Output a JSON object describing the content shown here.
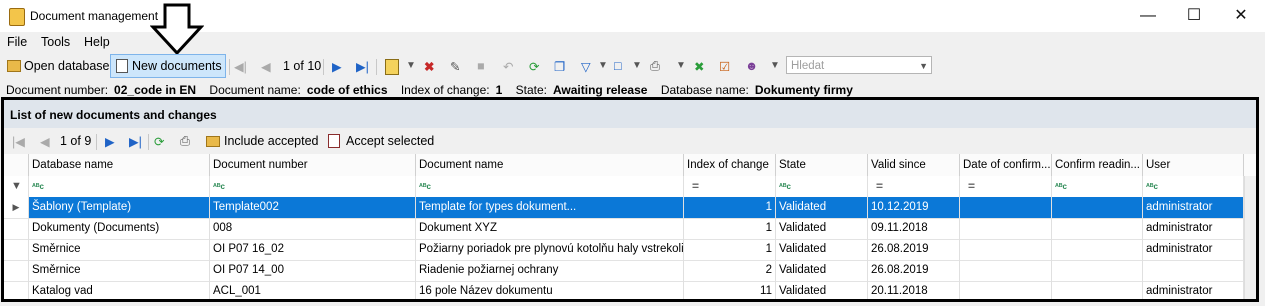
{
  "window": {
    "title": "Document management"
  },
  "menu": [
    "File",
    "Tools",
    "Help"
  ],
  "toolbar": {
    "open_database": "Open database",
    "new_documents": "New documents",
    "page_info": "1 of 10",
    "search_placeholder": "Hledat"
  },
  "info": {
    "document_number_label": "Document number:",
    "document_number": "02_code in EN",
    "document_name_label": "Document name:",
    "document_name": "code of ethics",
    "index_label": "Index of change:",
    "index": "1",
    "state_label": "State:",
    "state": "Awaiting release",
    "database_label": "Database name:",
    "database": "Dokumenty firmy"
  },
  "panel": {
    "title": "List of new documents and changes",
    "page_info": "1 of 9",
    "include_accepted": "Include accepted",
    "accept_selected": "Accept selected"
  },
  "columns": [
    "Database name",
    "Document number",
    "Document name",
    "Index of change",
    "State",
    "Valid since",
    "Date of confirm...",
    "Confirm readin...",
    "User"
  ],
  "filter_glyphs": [
    "ᴬᴮc",
    "ᴬᴮc",
    "ᴬᴮc",
    "=",
    "ᴬᴮc",
    "=",
    "=",
    "ᴬᴮc",
    "ᴬᴮc"
  ],
  "rows": [
    [
      "Šablony (Template)",
      "Template002",
      "Template for types dokument...",
      "1",
      "Validated",
      "10.12.2019",
      "",
      "",
      "administrator"
    ],
    [
      "Dokumenty (Documents)",
      "008",
      "Dokument XYZ",
      "1",
      "Validated",
      "09.11.2018",
      "",
      "",
      "administrator"
    ],
    [
      "Směrnice",
      "OI P07 16_02",
      "Požiarny poriadok pre plynovú kotolňu haly vstrekoli...",
      "1",
      "Validated",
      "26.08.2019",
      "",
      "",
      "administrator"
    ],
    [
      "Směrnice",
      "OI P07 14_00",
      "Riadenie požiarnej ochrany",
      "2",
      "Validated",
      "26.08.2019",
      "",
      "",
      ""
    ],
    [
      "Katalog vad",
      "ACL_001",
      "16 pole Název dokumentu",
      "11",
      "Validated",
      "20.11.2018",
      "",
      "",
      "administrator"
    ]
  ]
}
